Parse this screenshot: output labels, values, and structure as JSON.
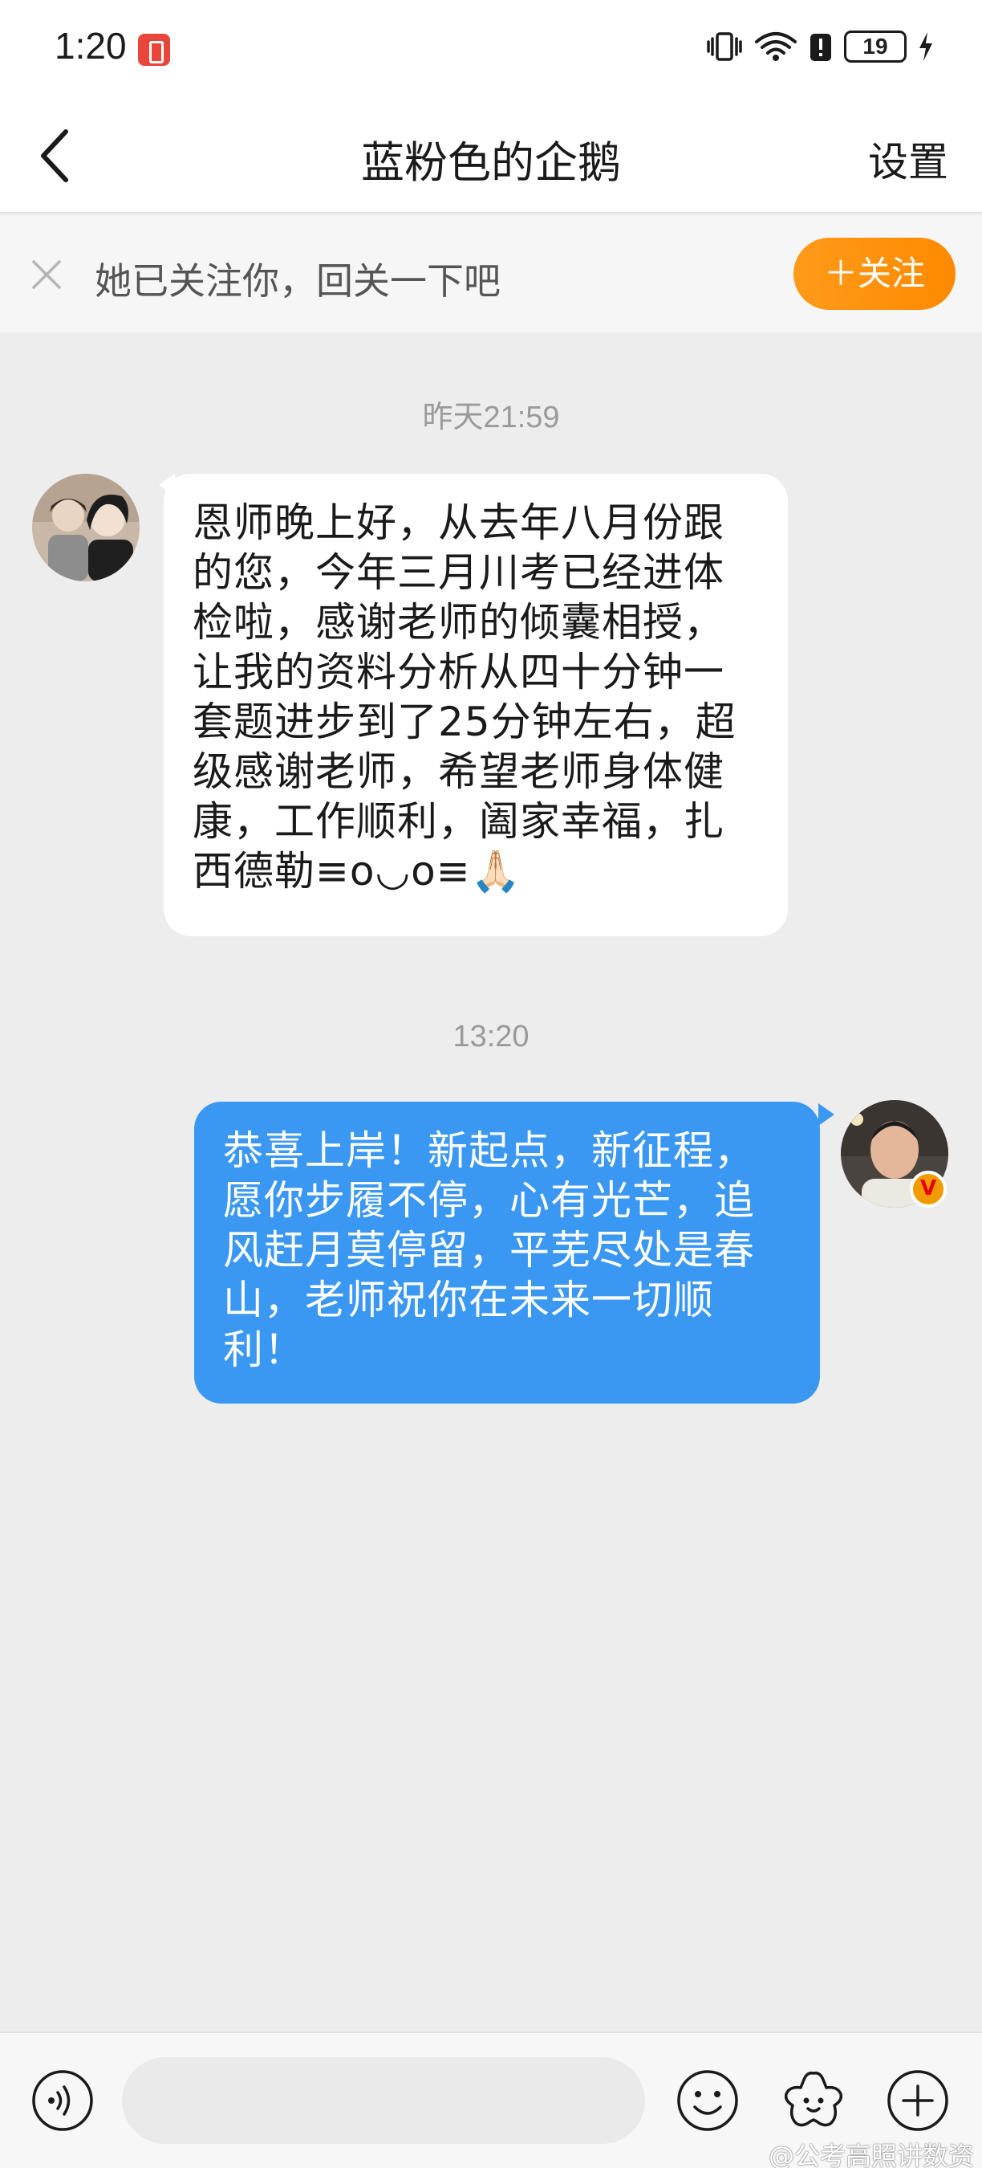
{
  "status_bar": {
    "time": "1:20",
    "battery": "19"
  },
  "nav": {
    "title": "蓝粉色的企鹅",
    "settings_label": "设置"
  },
  "follow_banner": {
    "text": "她已关注你，回关一下吧",
    "button_label": "＋关注"
  },
  "messages": [
    {
      "timestamp": "昨天21:59",
      "sender": "other",
      "text": "恩师晚上好，从去年八月份跟的您，今年三月川考已经进体检啦，感谢老师的倾囊相授，让我的资料分析从四十分钟一套题进步到了25分钟左右，超级感谢老师，希望老师身体健康，工作顺利，阖家幸福，扎西德勒≡o◡o≡🙏🏻"
    },
    {
      "timestamp": "13:20",
      "sender": "me",
      "text": "恭喜上岸！新起点，新征程，愿你步履不停，心有光芒，追风赶月莫停留，平芜尽处是春山，老师祝你在未来一切顺利！",
      "verified_badge": "V"
    }
  ],
  "bottom_bar": {
    "input_value": "",
    "input_placeholder": ""
  },
  "watermark": "@公考高照讲数资",
  "colors": {
    "accent_orange": "#ff8a00",
    "bubble_blue": "#3a98f3",
    "chat_background": "#ededed"
  },
  "icons": [
    "recording-icon",
    "vibrate-icon",
    "wifi-icon",
    "alert-icon",
    "charging-icon",
    "back-arrow-icon",
    "close-icon",
    "voice-icon",
    "emoji-icon",
    "sticker-icon",
    "plus-icon"
  ]
}
